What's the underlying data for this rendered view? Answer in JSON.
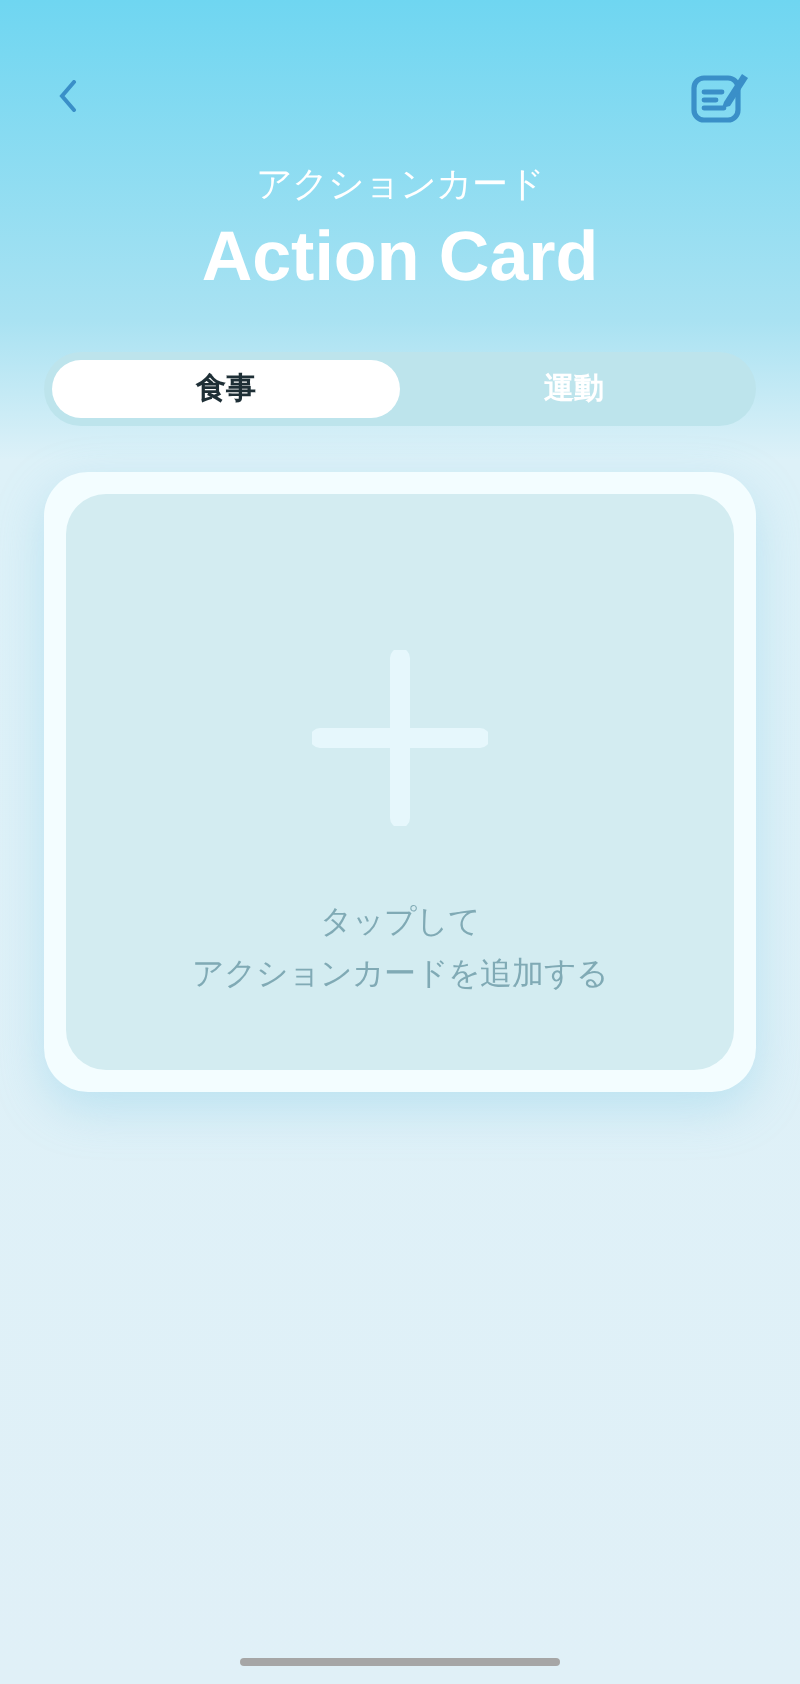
{
  "header": {
    "subtitle": "アクションカード",
    "title": "Action Card"
  },
  "tabs": [
    {
      "label": "食事",
      "selected": true
    },
    {
      "label": "運動",
      "selected": false
    }
  ],
  "add_card": {
    "lines": [
      "タップして",
      "アクションカードを追加する"
    ]
  }
}
